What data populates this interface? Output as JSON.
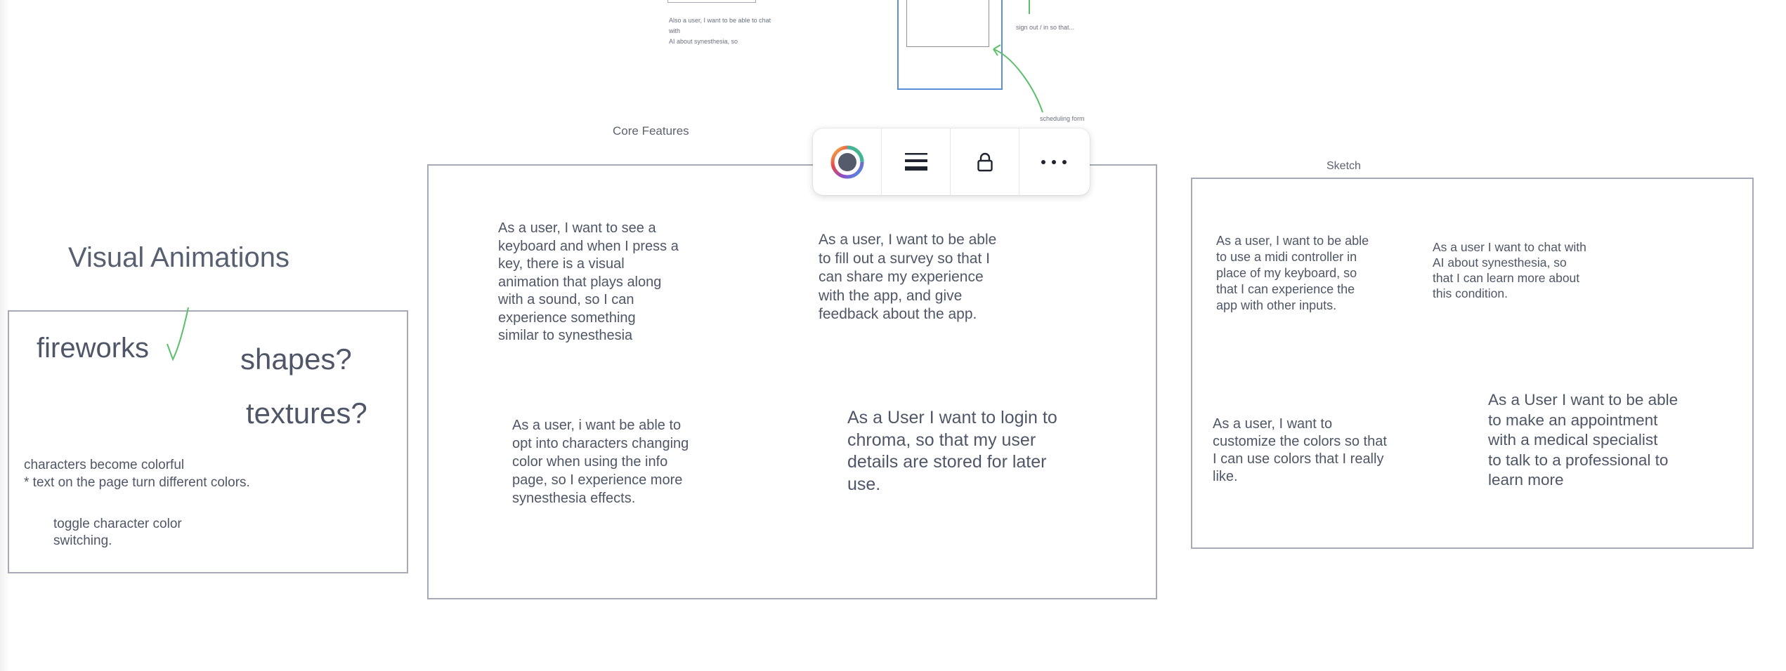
{
  "top_fragments": {
    "left_text": "Also a user, I want to be able to chat with\nAI about synesthesia, so",
    "right_text": "sign out / in so that...",
    "scheduling_label": "scheduling form"
  },
  "core_features": {
    "label": "Core Features",
    "stories": [
      "As a user, I want to see a\nkeyboard and when I press a\nkey, there is a visual\nanimation that plays along\nwith a sound, so I can\nexperience something\nsimilar to synesthesia",
      "As a user, I want to be able\nto fill out a survey so that I\ncan share my experience\nwith the app, and give\nfeedback about the app.",
      "As a user, i want be able to\nopt into characters changing\ncolor when using the info\npage, so I experience more\nsynesthesia effects.",
      "As a User I want to login to\nchroma, so that my user\ndetails are stored for later\nuse."
    ]
  },
  "sketch": {
    "label": "Sketch",
    "stories": [
      "As a user, I want to be able\nto use a midi controller in\nplace of my keyboard, so\nthat I can experience the\napp with other inputs.",
      "As a user I want to chat with\nAI about synesthesia, so\nthat I can learn more about\nthis condition.",
      "As a user, I want to\ncustomize the colors so that\nI can use colors that I really\nlike.",
      "As a User I want to be able\nto make an appointment\nwith a medical specialist\nto talk to a professional to\nlearn more"
    ]
  },
  "visual_animations": {
    "title": "Visual Animations",
    "fireworks": "fireworks",
    "shapes": "shapes?",
    "textures": "textures?",
    "note_characters": "characters become colorful\n   * text on the page turn different colors.",
    "note_toggle": "toggle character color\nswitching."
  },
  "toolbar": {
    "items": [
      "color-picker",
      "stroke-style",
      "lock",
      "more"
    ],
    "ellipsis": "···"
  },
  "colors": {
    "frame_border": "#a6aab6",
    "blue_frame": "#5b8fd6",
    "green_stroke": "#5bbf6a",
    "text": "#4f5667"
  }
}
